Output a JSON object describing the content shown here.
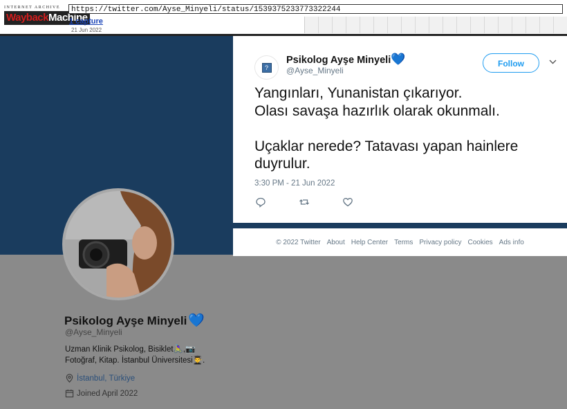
{
  "wayback": {
    "logo_top": "INTERNET ARCHIVE",
    "logo_way": "Wayback",
    "logo_machine": "Machine",
    "url": "https://twitter.com/Ayse_Minyeli/status/1539375233773322244",
    "captures": "1 capture",
    "capture_date": "21 Jun 2022"
  },
  "profile": {
    "name": "Psikolog Ayşe Minyeli",
    "handle": "@Ayse_Minyeli",
    "bio_line1": "Uzman Klinik Psikolog, Bisiklet🚴‍♀️,📷",
    "bio_line2": "Fotoğraf, Kitap. İstanbul Üniversitesi👨‍🎓.",
    "location": "İstanbul, Türkiye",
    "joined": "Joined April 2022"
  },
  "tweet": {
    "name": "Psikolog Ayşe Minyeli",
    "handle": "@Ayse_Minyeli",
    "follow_label": "Follow",
    "lines": [
      "Yangınları, Yunanistan çıkarıyor.",
      "Olası savaşa hazırlık olarak okunmalı.",
      "",
      "Uçaklar nerede? Tatavası yapan hainlere",
      "duyrulur."
    ],
    "timestamp": "3:30 PM - 21 Jun 2022"
  },
  "footer": {
    "links": [
      "© 2022 Twitter",
      "About",
      "Help Center",
      "Terms",
      "Privacy policy",
      "Cookies",
      "Ads info"
    ]
  },
  "colors": {
    "banner": "#1a3c5e",
    "verified_heart": "#6aa2e6",
    "follow_blue": "#1d9bf0",
    "wayback_red": "#d21d1d"
  }
}
